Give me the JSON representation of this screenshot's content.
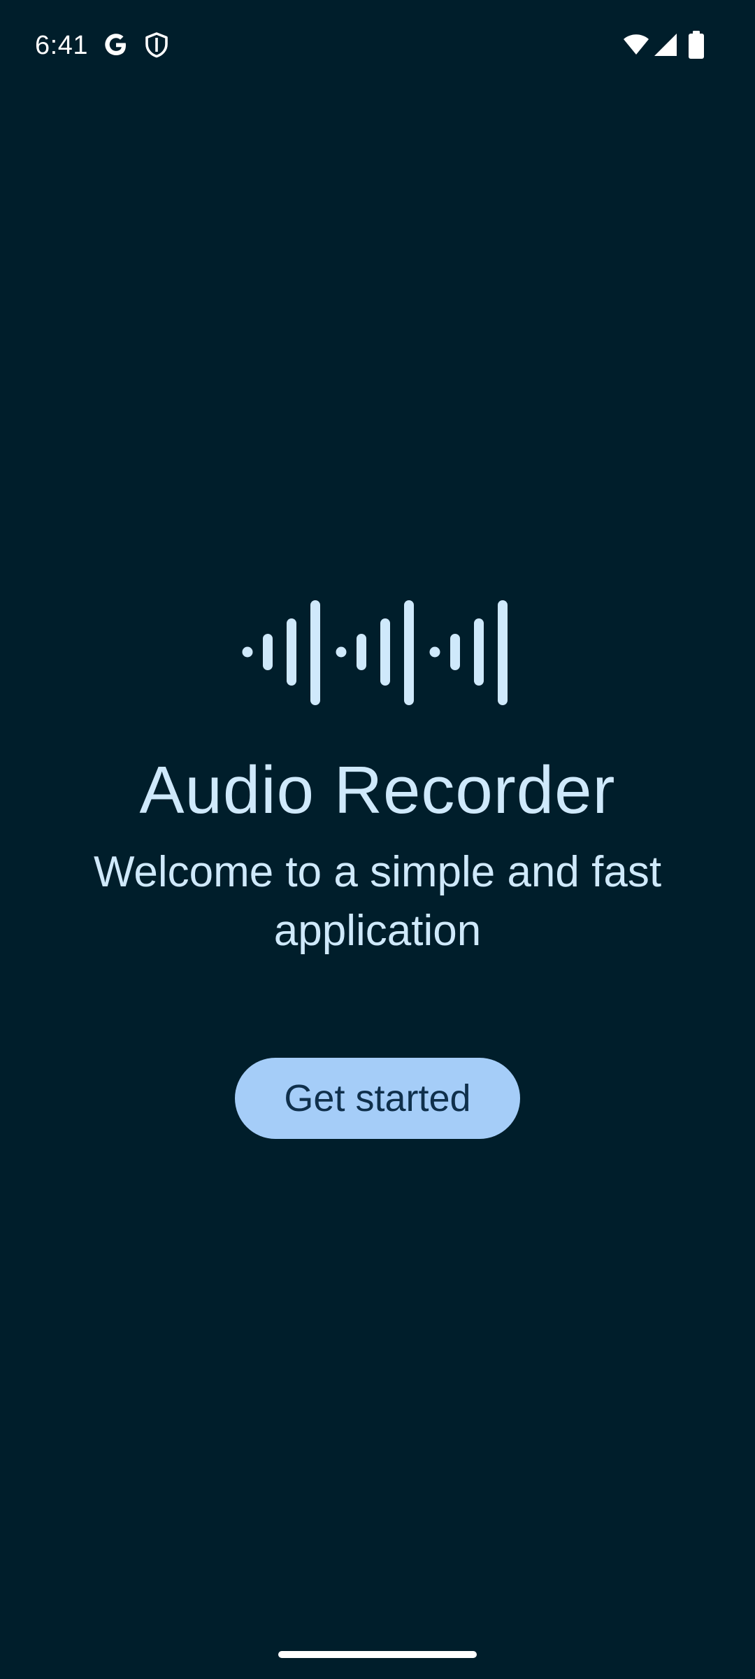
{
  "status_bar": {
    "time": "6:41",
    "left_icons": [
      "google-g-icon",
      "shield-icon"
    ],
    "right_icons": [
      "wifi-icon",
      "cell-signal-icon",
      "battery-icon"
    ]
  },
  "welcome": {
    "logo_icon": "sound-wave-icon",
    "title": "Audio Recorder",
    "subtitle": "Welcome to a simple and fast application",
    "cta_label": "Get started"
  },
  "colors": {
    "background": "#001e2b",
    "accent_text": "#cfe9fb",
    "button_bg": "#a5cdf8",
    "button_text": "#0f2f4b"
  }
}
